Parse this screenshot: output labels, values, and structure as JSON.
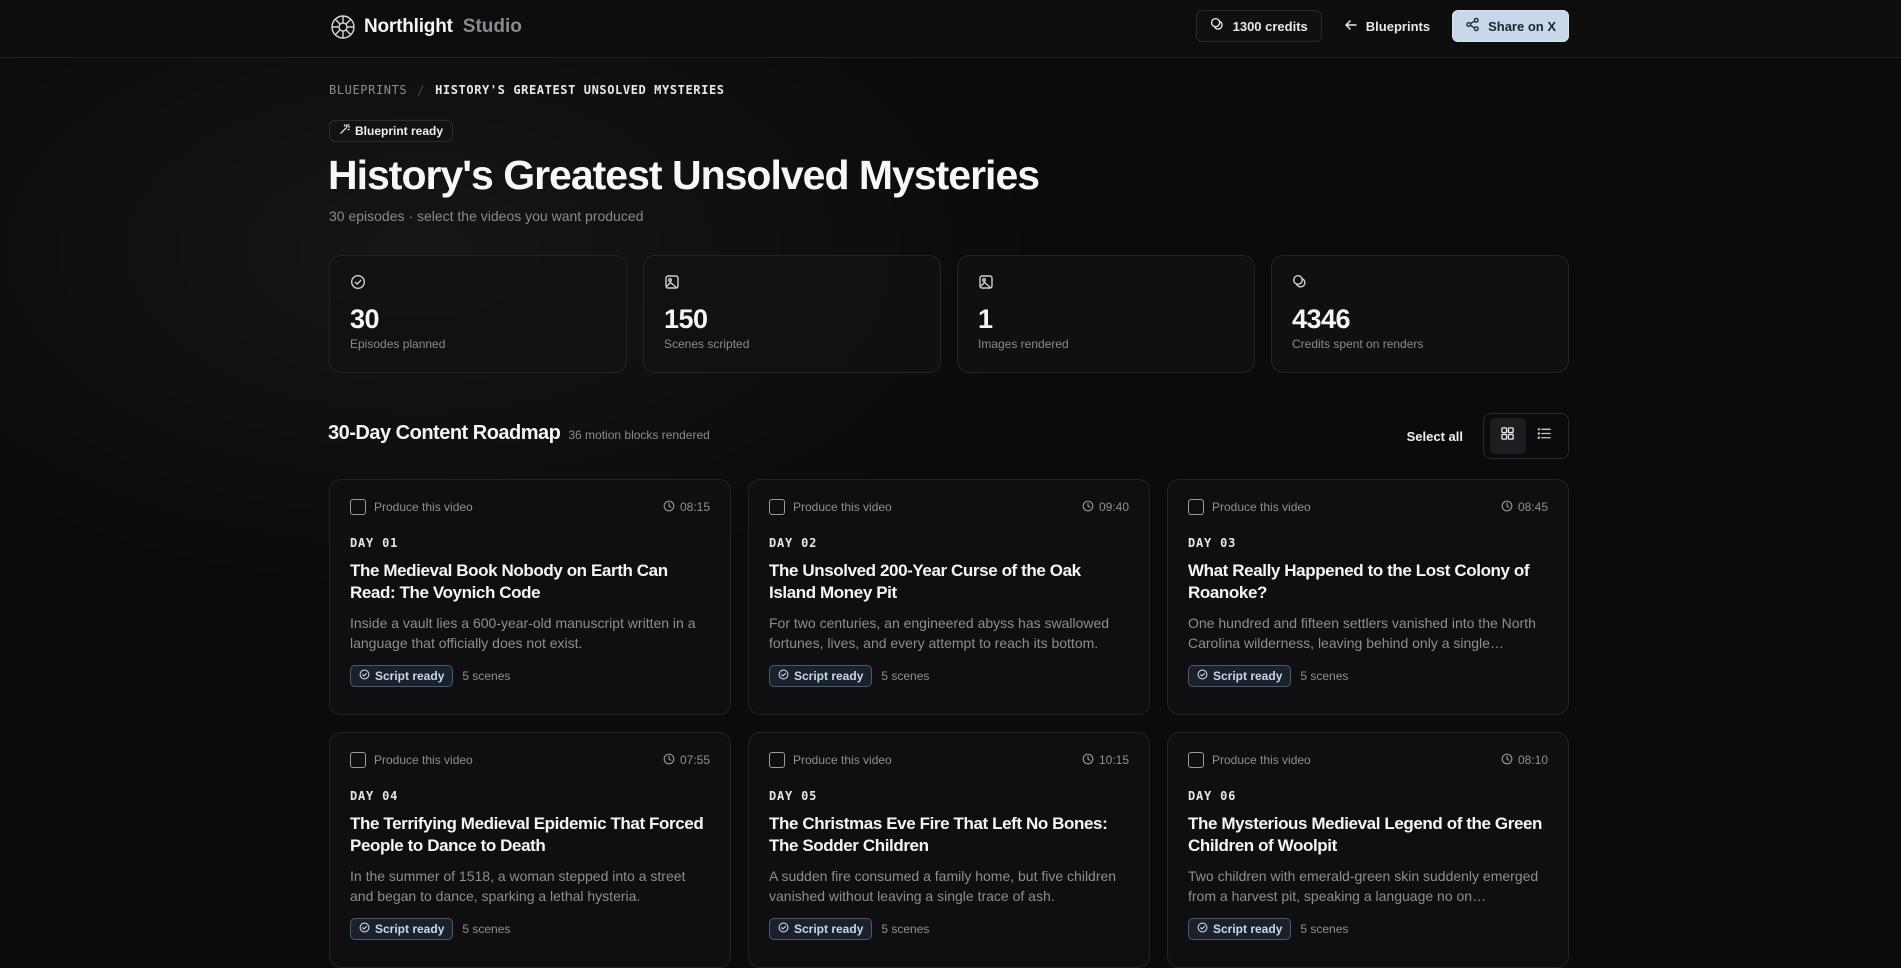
{
  "header": {
    "brand_name": "Northlight",
    "brand_sub": "Studio",
    "credits_label": "1300 credits",
    "back_label": "Blueprints",
    "share_label": "Share on X"
  },
  "breadcrumb": {
    "parent": "BLUEPRINTS",
    "separator": "/",
    "current": "HISTORY'S GREATEST UNSOLVED MYSTERIES"
  },
  "status_chip": "Blueprint ready",
  "page": {
    "title": "History's Greatest Unsolved Mysteries",
    "subtitle": "30 episodes · select the videos you want produced"
  },
  "stats": [
    {
      "icon": "check-circle-icon",
      "value": "30",
      "label": "Episodes planned"
    },
    {
      "icon": "image-icon",
      "value": "150",
      "label": "Scenes scripted"
    },
    {
      "icon": "image-icon",
      "value": "1",
      "label": "Images rendered"
    },
    {
      "icon": "coins-icon",
      "value": "4346",
      "label": "Credits spent on renders"
    }
  ],
  "roadmap": {
    "title": "30-Day Content Roadmap",
    "meta": "36 motion blocks rendered",
    "select_all": "Select all"
  },
  "cards": [
    {
      "produce_label": "Produce this video",
      "duration": "08:15",
      "day": "DAY 01",
      "title": "The Medieval Book Nobody on Earth Can Read: The Voynich Code",
      "desc": "Inside a vault lies a 600-year-old manuscript written in a language that officially does not exist.",
      "badge": "Script ready",
      "scenes": "5 scenes"
    },
    {
      "produce_label": "Produce this video",
      "duration": "09:40",
      "day": "DAY 02",
      "title": "The Unsolved 200-Year Curse of the Oak Island Money Pit",
      "desc": "For two centuries, an engineered abyss has swallowed fortunes, lives, and every attempt to reach its bottom.",
      "badge": "Script ready",
      "scenes": "5 scenes"
    },
    {
      "produce_label": "Produce this video",
      "duration": "08:45",
      "day": "DAY 03",
      "title": "What Really Happened to the Lost Colony of Roanoke?",
      "desc": "One hundred and fifteen settlers vanished into the North Carolina wilderness, leaving behind only a single…",
      "badge": "Script ready",
      "scenes": "5 scenes"
    },
    {
      "produce_label": "Produce this video",
      "duration": "07:55",
      "day": "DAY 04",
      "title": "The Terrifying Medieval Epidemic That Forced People to Dance to Death",
      "desc": "In the summer of 1518, a woman stepped into a street and began to dance, sparking a lethal hysteria.",
      "badge": "Script ready",
      "scenes": "5 scenes"
    },
    {
      "produce_label": "Produce this video",
      "duration": "10:15",
      "day": "DAY 05",
      "title": "The Christmas Eve Fire That Left No Bones: The Sodder Children",
      "desc": "A sudden fire consumed a family home, but five children vanished without leaving a single trace of ash.",
      "badge": "Script ready",
      "scenes": "5 scenes"
    },
    {
      "produce_label": "Produce this video",
      "duration": "08:10",
      "day": "DAY 06",
      "title": "The Mysterious Medieval Legend of the Green Children of Woolpit",
      "desc": "Two children with emerald-green skin suddenly emerged from a harvest pit, speaking a language no on…",
      "badge": "Script ready",
      "scenes": "5 scenes"
    }
  ],
  "colors": {
    "background": "#0b0b0c",
    "accent": "#c8d7ea",
    "muted_text": "#8a8a90"
  }
}
